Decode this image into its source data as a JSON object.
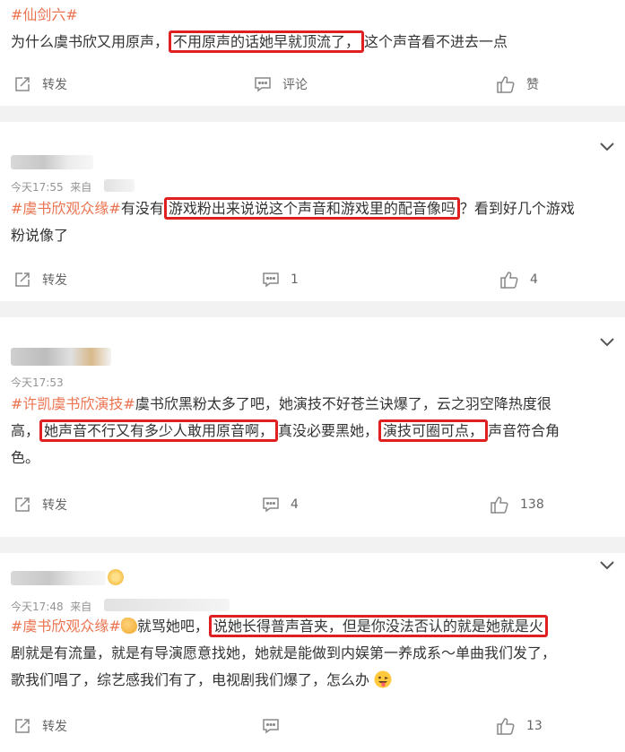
{
  "posts": [
    {
      "tag": "#仙剑六#",
      "text_a": "为什么虞书欣又用原声，",
      "highlight_a": "不用原声的话她早就顶流了，",
      "text_b": "这个声音看不进去一点",
      "repost": "转发",
      "comment": "评论",
      "like": "赞"
    },
    {
      "time": "今天17:55",
      "from": "来自",
      "tag": "#虞书欣观众缘#",
      "text_a": "有没有",
      "highlight_a": "游戏粉出来说说这个声音和游戏里的配音像吗",
      "text_b": "？看到好几个游戏",
      "text_c": "粉说像了",
      "repost": "转发",
      "comment": "1",
      "like": "4"
    },
    {
      "time": "今天17:53",
      "tag": "#许凯虞书欣演技#",
      "text_a": "虞书欣黑粉太多了吧，她演技不好苍兰诀爆了，云之羽空降热度很",
      "text_b": "高，",
      "highlight_a": "她声音不行又有多少人敢用原音啊，",
      "text_c": "真没必要黑她，",
      "highlight_b": "演技可圈可点，",
      "text_d": "声音符合角",
      "text_e": "色。",
      "repost": "转发",
      "comment": "4",
      "like": "138"
    },
    {
      "time": "今天17:48",
      "from": "来自",
      "tag": "#虞书欣观众缘#",
      "text_a": "就骂她吧，",
      "highlight_a": "说她长得普声音夹，但是你没法否认的就是她就是火",
      "text_b": "剧就是有流量，就是有导演愿意找她，她就是能做到内娱第一养成系～单曲我们发了，",
      "text_c": "歌我们唱了，综艺感我们有了，电视剧我们爆了，怎么办",
      "repost": "转发",
      "comment": "",
      "like": "13"
    }
  ],
  "icons": {
    "repost": "share-icon",
    "comment": "comment-icon",
    "like": "thumbs-up-icon",
    "expand": "chevron-down-icon",
    "emoji_grin": "grinning-tongue-emoji",
    "emoji_hand": "clapping-hand-emoji",
    "emoji_sparkle": "sparkle-emoji"
  },
  "colors": {
    "tag": "#eb7350",
    "highlight_border": "#e02020",
    "separator": "#f2f2f2",
    "meta": "#939393"
  }
}
